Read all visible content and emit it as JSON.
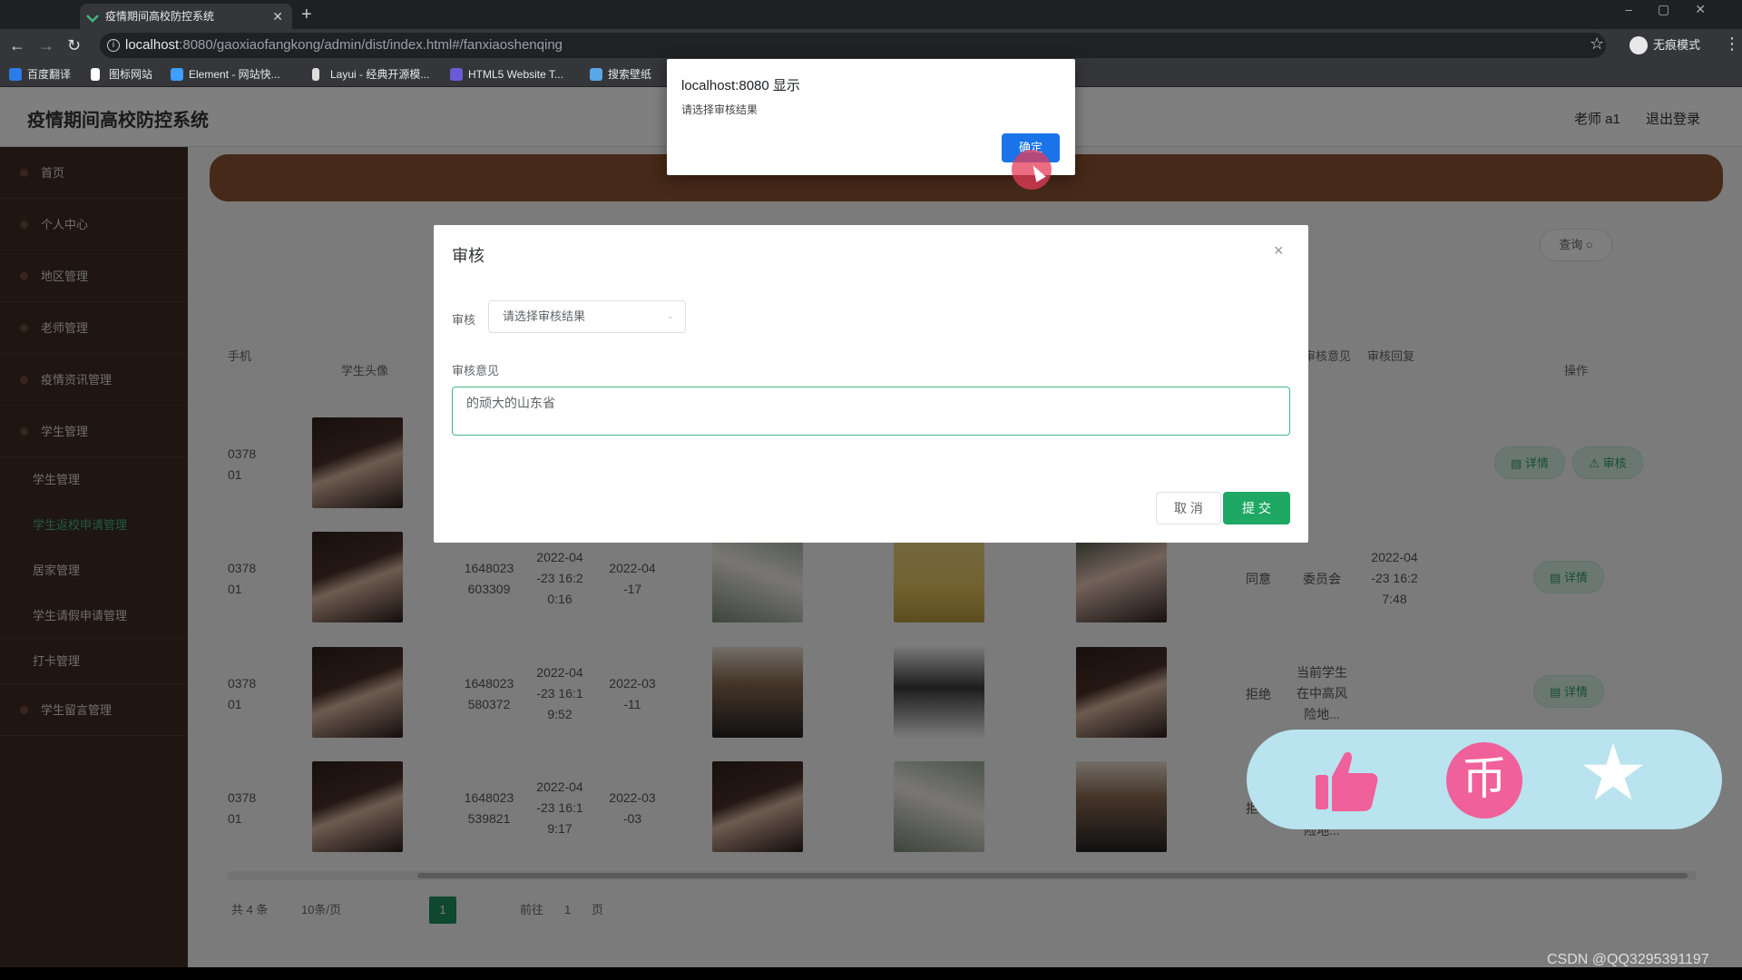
{
  "browser": {
    "tab_title": "疫情期间高校防控系统",
    "new_tab": "+",
    "url_host": "localhost",
    "url_path": ":8080/gaoxiaofangkong/admin/dist/index.html#/fanxiaoshenqing",
    "incognito_label": "无痕模式",
    "bookmarks": [
      "百度翻译",
      "图标网站",
      "Element - 网站快...",
      "Layui - 经典开源模...",
      "HTML5 Website T...",
      "搜索壁纸"
    ]
  },
  "header": {
    "system_title": "疫情期间高校防控系统",
    "user": "老师 a1",
    "logout": "退出登录"
  },
  "sidebar": {
    "items": [
      {
        "label": "首页"
      },
      {
        "label": "个人中心"
      },
      {
        "label": "地区管理"
      },
      {
        "label": "老师管理"
      },
      {
        "label": "疫情资讯管理"
      },
      {
        "label": "学生管理"
      }
    ],
    "sub_items": [
      {
        "label": "学生管理"
      },
      {
        "label": "学生返校申请管理"
      },
      {
        "label": "居家管理"
      },
      {
        "label": "学生请假申请管理"
      },
      {
        "label": "打卡管理"
      },
      {
        "label": "学生留言管理"
      }
    ]
  },
  "toolbar": {
    "search_label": "查询"
  },
  "table": {
    "headers": {
      "phone": "手机",
      "avatar": "学生头像",
      "opinion": "审核意见",
      "audit_time": "审核回复",
      "ops": "操作"
    },
    "rows": [
      {
        "phone": "0378\n01",
        "id": "",
        "apply_time": "",
        "return_date": "",
        "result": "",
        "opinion": "",
        "reply_time": ""
      },
      {
        "phone": "0378\n01",
        "id": "1648023\n603309",
        "apply_time": "2022-04\n-23 16:2\n0:16",
        "return_date": "2022-04\n-17",
        "result": "同意",
        "opinion": "委员会",
        "reply_time": "2022-04\n-23 16:2\n7:48"
      },
      {
        "phone": "0378\n01",
        "id": "1648023\n580372",
        "apply_time": "2022-04\n-23 16:1\n9:52",
        "return_date": "2022-03\n-11",
        "result": "拒绝",
        "opinion": "当前学生\n在中高风\n险地...",
        "reply_time": ""
      },
      {
        "phone": "0378\n01",
        "id": "1648023\n539821",
        "apply_time": "2022-04\n-23 16:1\n9:17",
        "return_date": "2022-03\n-03",
        "result": "拒绝",
        "opinion": "险地...",
        "reply_time": ""
      }
    ],
    "detail_label": "详情",
    "audit_label": "审核"
  },
  "pagination": {
    "total": "共 4 条",
    "page_size": "10条/页",
    "current": "1",
    "goto_label": "前往",
    "goto_value": "1",
    "page_suffix": "页"
  },
  "modal": {
    "title": "审核",
    "close": "×",
    "audit_label": "审核",
    "audit_placeholder": "请选择审核结果",
    "opinion_label": "审核意见",
    "opinion_value": "的顽大的山东省",
    "cancel": "取 消",
    "submit": "提 交"
  },
  "alert": {
    "title": "localhost:8080 显示",
    "message": "请选择审核结果",
    "ok": "确定"
  },
  "watermark": "CSDN @QQ3295391197",
  "colors": {
    "sidebar_bg": "#3f2b22",
    "banner": "#8c5330",
    "accent_green": "#1fa863",
    "alert_button": "#1a73e8"
  }
}
